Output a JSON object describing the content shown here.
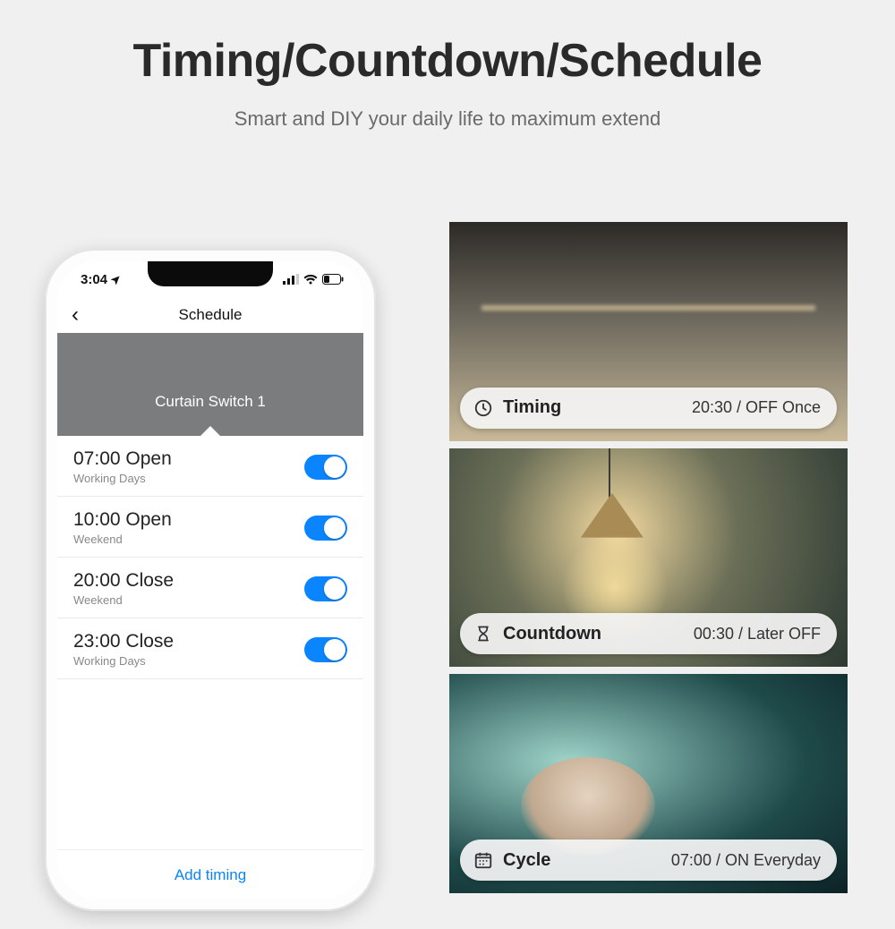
{
  "headline": "Timing/Countdown/Schedule",
  "subhead": "Smart and DIY your daily life to maximum extend",
  "phone": {
    "status_time": "3:04",
    "nav_title": "Schedule",
    "device_name": "Curtain Switch 1",
    "rows": [
      {
        "time": "07:00",
        "action": "Open",
        "days": "Working Days"
      },
      {
        "time": "10:00",
        "action": "Open",
        "days": "Weekend"
      },
      {
        "time": "20:00",
        "action": "Close",
        "days": "Weekend"
      },
      {
        "time": "23:00",
        "action": "Close",
        "days": "Working Days"
      }
    ],
    "add_label": "Add timing"
  },
  "tiles": [
    {
      "label": "Timing",
      "value": "20:30 / OFF Once"
    },
    {
      "label": "Countdown",
      "value": "00:30 / Later OFF"
    },
    {
      "label": "Cycle",
      "value": "07:00 / ON Everyday"
    }
  ]
}
